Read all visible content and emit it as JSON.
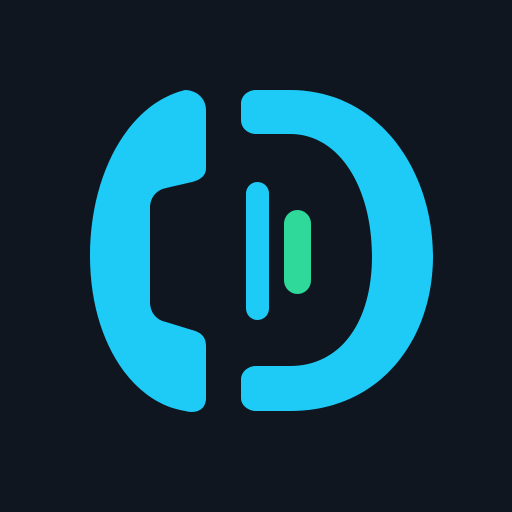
{
  "icon": {
    "name": "phone-handset-d-logo-icon",
    "colors": {
      "background": "#0f161f",
      "primary": "#1ecbf7",
      "accent": "#2ed99a"
    }
  }
}
